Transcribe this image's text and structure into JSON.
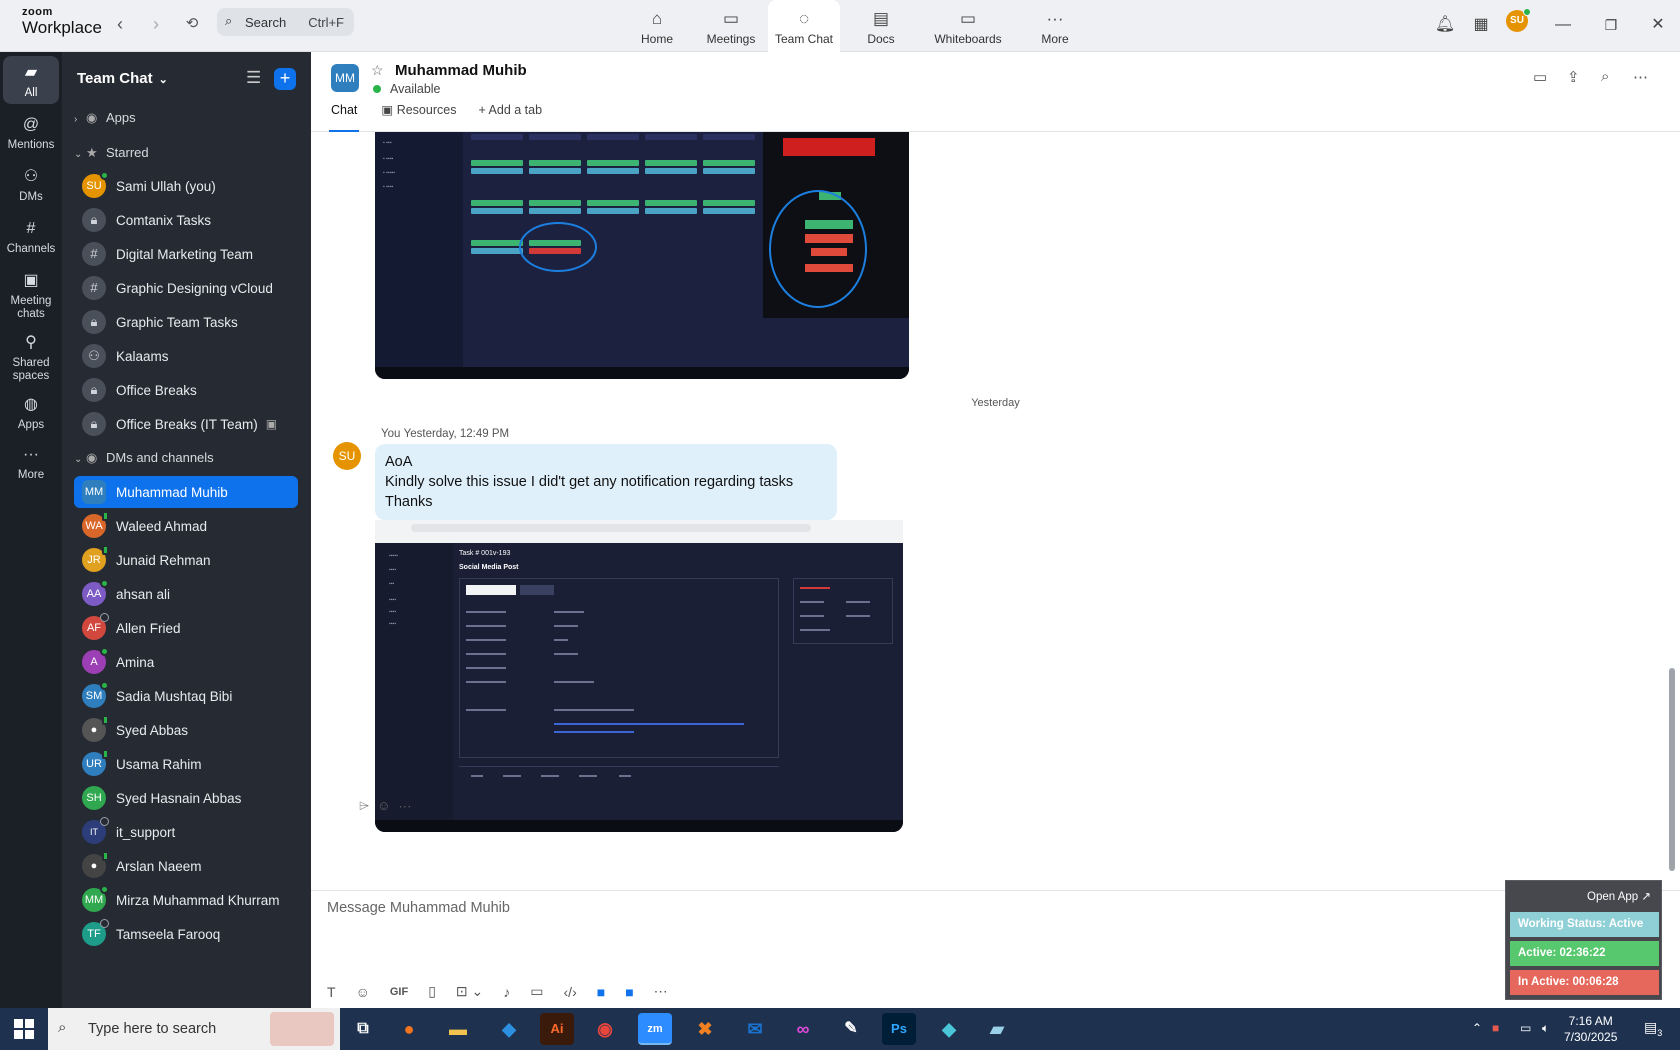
{
  "app": {
    "brand_top": "zoom",
    "brand_bottom": "Workplace"
  },
  "topbar": {
    "search_label": "Search",
    "search_shortcut": "Ctrl+F",
    "tabs": [
      {
        "label": "Home",
        "icon": "home-icon"
      },
      {
        "label": "Meetings",
        "icon": "video-camera-icon"
      },
      {
        "label": "Team Chat",
        "icon": "chat-bubble-icon"
      },
      {
        "label": "Docs",
        "icon": "document-icon"
      },
      {
        "label": "Whiteboards",
        "icon": "whiteboard-icon"
      },
      {
        "label": "More",
        "icon": "more-dots-icon"
      }
    ],
    "active_tab": "Team Chat",
    "user_initials": "SU"
  },
  "rail": {
    "items": [
      {
        "label": "All",
        "icon": "chat-bubble-icon"
      },
      {
        "label": "Mentions",
        "icon": "at-sign-icon"
      },
      {
        "label": "DMs",
        "icon": "people-icon"
      },
      {
        "label": "Channels",
        "icon": "hash-icon"
      },
      {
        "label_1": "Meeting",
        "label_2": "chats",
        "icon": "calendar-icon"
      },
      {
        "label_1": "Shared",
        "label_2": "spaces",
        "icon": "shared-icon"
      },
      {
        "label": "Apps",
        "icon": "apps-icon"
      },
      {
        "label": "More",
        "icon": "more-dots-icon"
      }
    ]
  },
  "sidebar": {
    "title": "Team Chat",
    "sections": {
      "apps": "Apps",
      "starred": "Starred",
      "dms": "DMs and channels"
    },
    "starred": [
      {
        "name": "Sami Ullah (you)",
        "initials": "SU",
        "color": "#e59400"
      },
      {
        "name": "Comtanix Tasks",
        "icon": "lock-icon"
      },
      {
        "name": "Digital Marketing Team",
        "icon": "hash-icon"
      },
      {
        "name": "Graphic Designing vCloud",
        "icon": "hash-icon"
      },
      {
        "name": "Graphic Team Tasks",
        "icon": "lock-icon"
      },
      {
        "name": "Kalaams",
        "icon": "people-icon"
      },
      {
        "name": "Office Breaks",
        "icon": "lock-icon"
      },
      {
        "name": "Office Breaks (IT Team)",
        "icon": "lock-icon"
      }
    ],
    "dms": [
      {
        "name": "Muhammad Muhib",
        "initials": "MM",
        "color": "#2f7fbf"
      },
      {
        "name": "Waleed Ahmad",
        "initials": "WA",
        "color": "#d9672a"
      },
      {
        "name": "Junaid Rehman",
        "initials": "JR",
        "color": "#e0a020"
      },
      {
        "name": "ahsan ali",
        "initials": "AA",
        "color": "#7c5cc4"
      },
      {
        "name": "Allen Fried",
        "initials": "AF",
        "color": "#d2483e"
      },
      {
        "name": "Amina",
        "initials": "A",
        "color": "#9c3fb5"
      },
      {
        "name": "Sadia Mushtaq Bibi",
        "initials": "SM",
        "color": "#2f7fbf"
      },
      {
        "name": "Syed Abbas",
        "initials": "",
        "color": "#555"
      },
      {
        "name": "Usama Rahim",
        "initials": "UR",
        "color": "#2f7fbf"
      },
      {
        "name": "Syed Hasnain Abbas",
        "initials": "SH",
        "color": "#2fa84f"
      },
      {
        "name": "it_support",
        "initials": "IT",
        "color": "#2c3d7a"
      },
      {
        "name": "Arslan Naeem",
        "initials": "",
        "color": "#444"
      },
      {
        "name": "Mirza Muhammad Khurram",
        "initials": "MM",
        "color": "#2fa84f"
      },
      {
        "name": "Tamseela Farooq",
        "initials": "TF",
        "color": "#1e9c8a"
      }
    ]
  },
  "chat": {
    "contact_initials": "MM",
    "contact_name": "Muhammad Muhib",
    "status": "Available",
    "tabs": [
      "Chat",
      "Resources",
      "Add a tab"
    ],
    "day_separator": "Yesterday",
    "message": {
      "sender": "You",
      "time": "Yesterday, 12:49 PM",
      "sender_initials": "SU",
      "lines": [
        "AoA",
        "Kindly solve this issue I did't  get any notification regarding tasks",
        "Thanks"
      ]
    },
    "screenshot2": {
      "task_id": "Task # 001v-193",
      "task_title": "Social Media Post"
    },
    "composer_placeholder": "Message Muhammad Muhib"
  },
  "widget": {
    "open_app": "Open App ↗",
    "working_status": "Working Status: Active",
    "active": "Active: 02:36:22",
    "inactive": "In Active: 00:06:28"
  },
  "taskbar": {
    "search_placeholder": "Type here to search",
    "time": "7:16 AM",
    "date": "7/30/2025",
    "notifications": "3"
  }
}
